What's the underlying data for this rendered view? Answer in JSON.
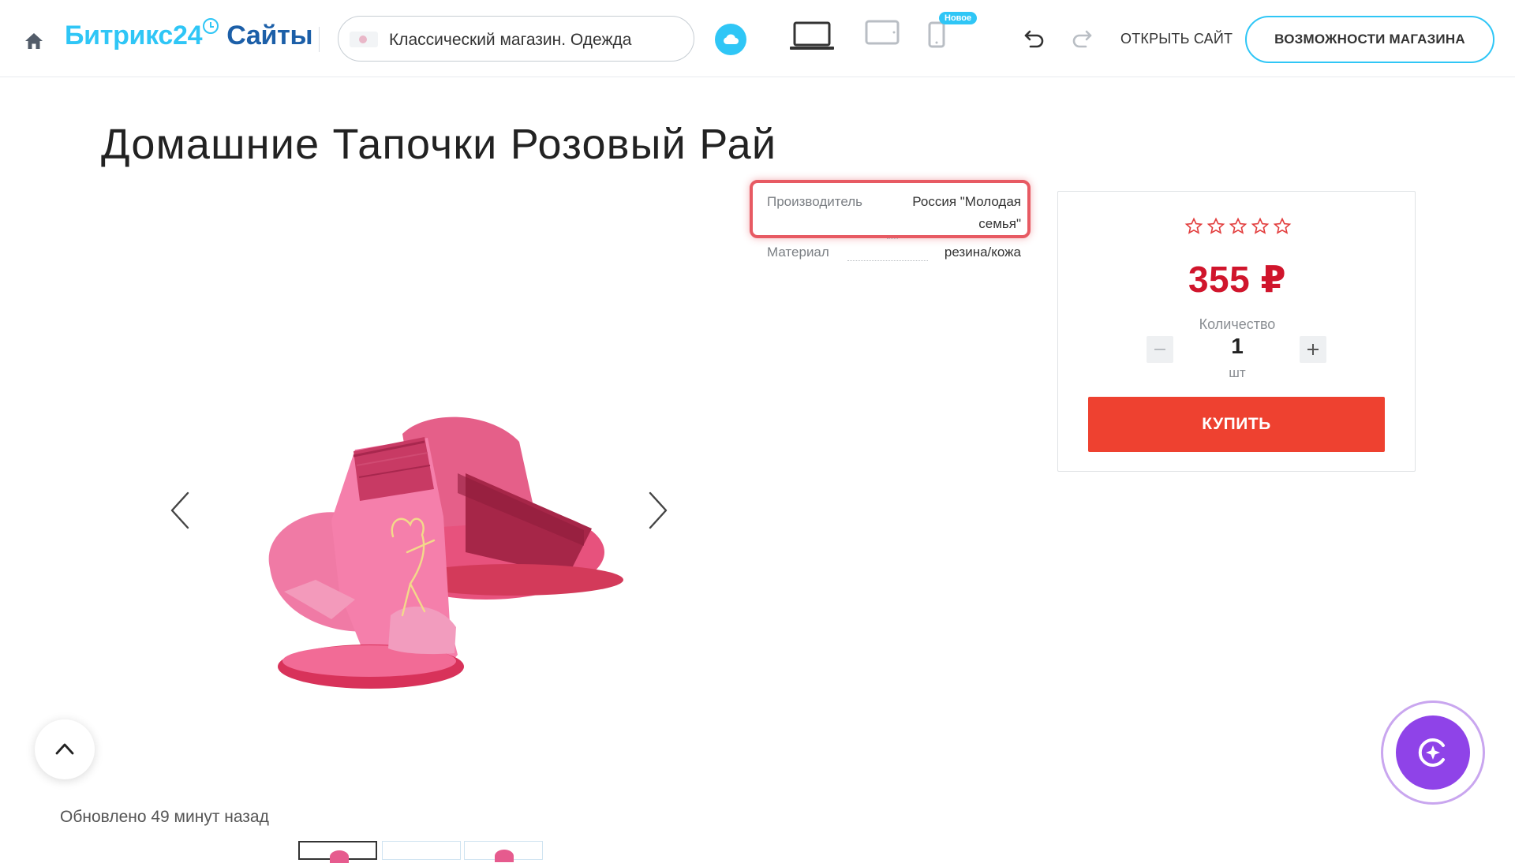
{
  "header": {
    "brand_name": "Битрикс24",
    "brand_suffix": "Сайты",
    "site_name": "Классический магазин. Одежда",
    "new_badge": "Новое",
    "open_site": "ОТКРЫТЬ САЙТ",
    "shop_features": "ВОЗМОЖНОСТИ МАГАЗИНА"
  },
  "product": {
    "title": "Домашние Тапочки Розовый Рай",
    "properties": [
      {
        "name": "Производитель",
        "value_line1": "Россия \"Молодая",
        "value_line2": "семья\""
      },
      {
        "name": "Материал",
        "value": "резина/кожа"
      }
    ],
    "rating": 0,
    "rating_max": 5,
    "price": "355 ₽",
    "quantity_label": "Количество",
    "quantity": "1",
    "unit": "шт",
    "buy_label": "КУПИТЬ"
  },
  "footer": {
    "updated": "Обновлено 49 минут назад"
  },
  "colors": {
    "accent": "#2fc6f6",
    "brand_dark": "#1c5fa8",
    "price": "#d0152c",
    "buy_button": "#ee4130",
    "highlight": "#e75a63",
    "ai_widget": "#8f43e8"
  },
  "icons": [
    "home-icon",
    "cloud-icon",
    "desktop-icon",
    "tablet-icon",
    "mobile-icon",
    "undo-icon",
    "redo-icon",
    "star-icon",
    "chevron-left-icon",
    "chevron-right-icon",
    "chevron-up-icon",
    "ai-assistant-icon"
  ]
}
